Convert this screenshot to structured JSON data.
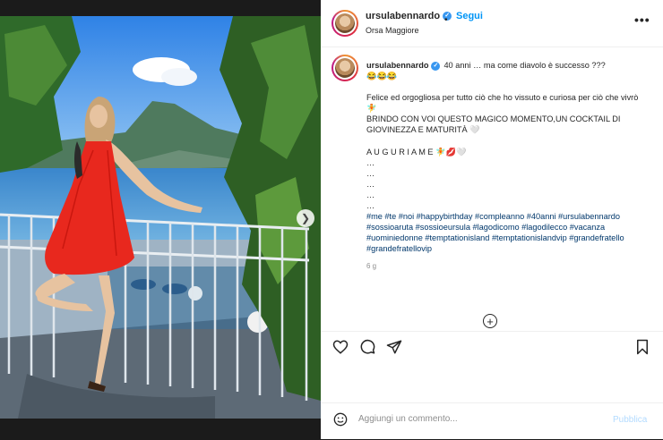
{
  "post": {
    "username": "ursulabennardo",
    "verified_mark": "✓",
    "follow_label": "Segui",
    "separator": "•",
    "location": "Orsa Maggiore",
    "more_label": "•••"
  },
  "caption": {
    "username": "ursulabennardo",
    "line1": "40 anni … ma come diavolo è successo ???",
    "line1_emoji": "😂😂😂",
    "line2": "Felice ed orgogliosa per tutto ciò che ho vissuto e curiosa per ciò che vivrò 🧚",
    "line3": "BRINDO CON VOI QUESTO MAGICO MOMENTO,UN COCKTAIL DI GIOVINEZZA E MATURITÀ 🤍",
    "line4": "A U G U R I A M E 🧚💋🤍",
    "dots": [
      "…",
      "…",
      "…",
      "…",
      "…"
    ],
    "hashtags": "#me #te #noi #happybirthday #compleanno #40anni #ursulabennardo #sossioaruta #sossioeursula #lagodicomo #lagodilecco #vacanza #uominiedonne #temptationisland #temptationislandvip #grandefratello #grandefratellovip",
    "time": "6 g"
  },
  "load_more_label": "+",
  "comment": {
    "placeholder": "Aggiungi un commento...",
    "publish_label": "Pubblica"
  },
  "icons": [
    "heart-icon",
    "comment-icon",
    "share-icon",
    "bookmark-icon",
    "emoji-icon",
    "chevron-right-icon",
    "more-icon"
  ],
  "colors": {
    "accent": "#0095f6",
    "hashtag": "#00376b",
    "dress": "#e8281e",
    "sky": "#3f8fe6",
    "lake": "#2f7fc8"
  }
}
